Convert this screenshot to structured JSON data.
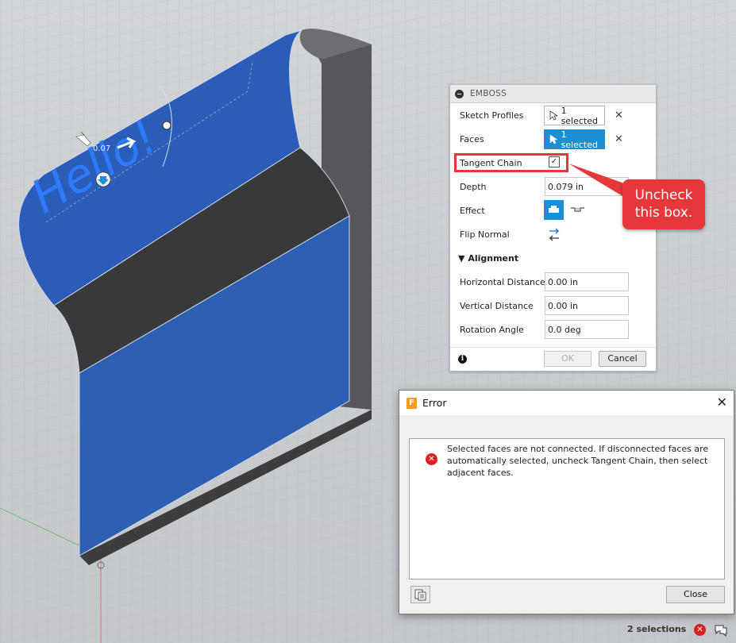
{
  "viewport": {
    "sketch_text": "Hello!",
    "dimension_text": "0.07"
  },
  "emboss": {
    "title": "EMBOSS",
    "sketch_profiles_label": "Sketch Profiles",
    "sketch_profiles_value": "1 selected",
    "faces_label": "Faces",
    "faces_value": "1 selected",
    "tangent_chain_label": "Tangent Chain",
    "tangent_chain_checked": true,
    "depth_label": "Depth",
    "depth_value": "0.079 in",
    "effect_label": "Effect",
    "flip_normal_label": "Flip Normal",
    "alignment_label": "Alignment",
    "horizontal_distance_label": "Horizontal Distance",
    "horizontal_distance_value": "0.00 in",
    "vertical_distance_label": "Vertical Distance",
    "vertical_distance_value": "0.00 in",
    "rotation_angle_label": "Rotation Angle",
    "rotation_angle_value": "0.0 deg",
    "ok_label": "OK",
    "cancel_label": "Cancel"
  },
  "callout": {
    "line1": "Uncheck",
    "line2": "this box."
  },
  "error_dialog": {
    "title": "Error",
    "message": "Selected faces are not connected. If disconnected faces are automatically selected, uncheck Tangent Chain, then select adjacent faces.",
    "close_label": "Close"
  },
  "status_bar": {
    "selections_text": "2 selections"
  },
  "colors": {
    "viewport_bg": "#c9ccd0",
    "face_blue": "#2456b0",
    "accent_blue": "#1b8fd6",
    "callout_red": "#e8373a"
  }
}
